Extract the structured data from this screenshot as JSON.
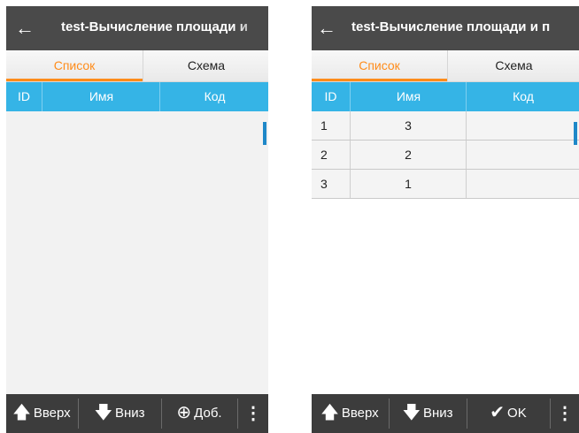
{
  "screen_left": {
    "title": "test-Вычисление площади и",
    "tabs": {
      "list": "Список",
      "scheme": "Схема"
    },
    "columns": {
      "id": "ID",
      "name": "Имя",
      "code": "Код"
    },
    "rows": [],
    "footer": {
      "up": "Вверх",
      "down": "Вниз",
      "add": "Доб.",
      "more": "⋮"
    }
  },
  "screen_right": {
    "title": "test-Вычисление площади и п",
    "tabs": {
      "list": "Список",
      "scheme": "Схема"
    },
    "columns": {
      "id": "ID",
      "name": "Имя",
      "code": "Код"
    },
    "rows": [
      {
        "id": "1",
        "name": "3",
        "code": ""
      },
      {
        "id": "2",
        "name": "2",
        "code": ""
      },
      {
        "id": "3",
        "name": "1",
        "code": ""
      }
    ],
    "footer": {
      "up": "Вверх",
      "down": "Вниз",
      "ok": "OK",
      "more": "⋮"
    }
  },
  "colors": {
    "titlebar": "#4a4a4a",
    "tab_active": "#ff8c1a",
    "table_header": "#35b4e6",
    "footer": "#3c3c3c",
    "scroll_indicator": "#1e88c8"
  }
}
